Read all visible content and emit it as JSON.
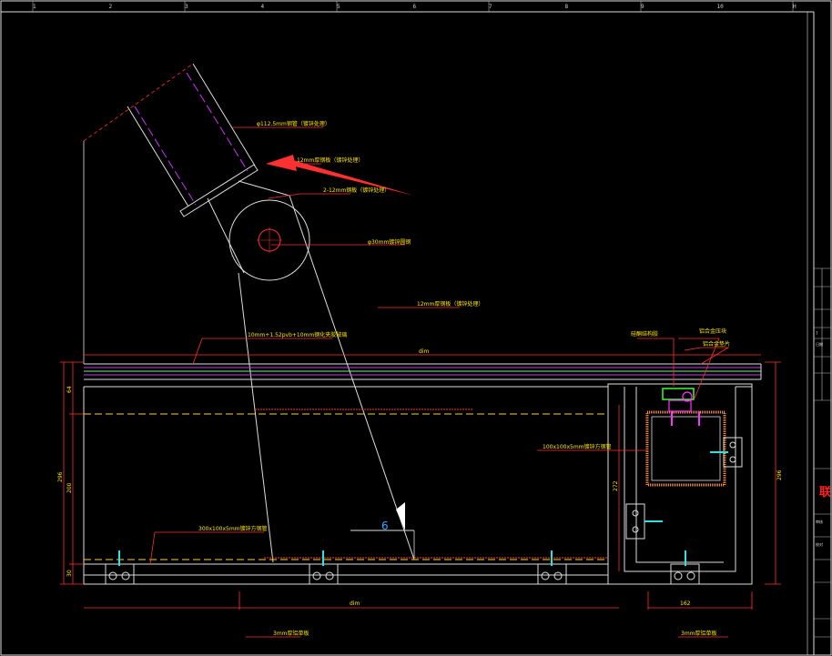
{
  "ruler_ticks": [
    "1",
    "2",
    "3",
    "4",
    "5",
    "6",
    "7",
    "8",
    "9",
    "10",
    "H"
  ],
  "labels": {
    "tube_spec": "φ112.5mm钢管（镀锌处理）",
    "plate_1": "12mm厚钢板（镀锌处理）",
    "plate_2": "2-12mm钢板（镀锌处理）",
    "pin": "φ30mm镀锌圆钢",
    "plate_3": "12mm厚钢板（镀锌处理）",
    "glass": "10mm+1.52pvb+10mm钢化夹胶玻璃",
    "rect_tube": "100x100x5mm镀锌方钢管",
    "bottom_tube": "300x100x5mm镀锌方钢管",
    "silicone": "硅酮结构胶",
    "clamp": "铝合金压块",
    "gasket": "铝合金垫片",
    "bottom_plate_1": "3mm厚铝单板",
    "bottom_plate_2": "3mm厚铝单板"
  },
  "dims": {
    "top_span": "dim",
    "bottom_span": "dim",
    "left_top": "64",
    "left_mid": "200",
    "left_total": "296",
    "left_bottom": "30",
    "right_total": "296",
    "bay_height": "272",
    "bottom_bay": "162"
  },
  "section_tag": "6",
  "title_block": {
    "logo": "联",
    "rows": [
      "7",
      "日期",
      "审核",
      "校对"
    ]
  }
}
